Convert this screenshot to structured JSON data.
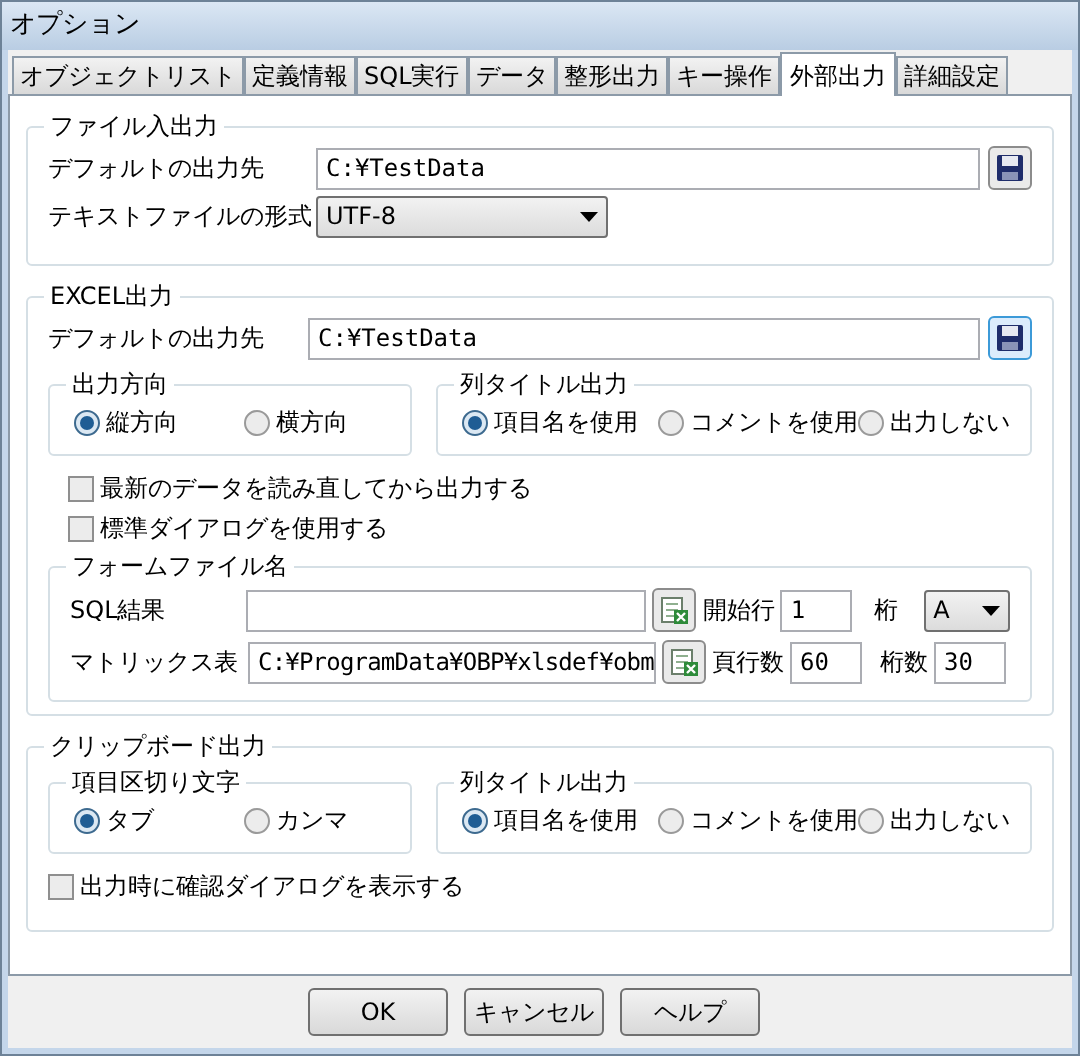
{
  "window": {
    "title": "オプション"
  },
  "tabs": [
    {
      "label": "オブジェクトリスト",
      "selected": false
    },
    {
      "label": "定義情報",
      "selected": false
    },
    {
      "label": "SQL実行",
      "selected": false
    },
    {
      "label": "データ",
      "selected": false
    },
    {
      "label": "整形出力",
      "selected": false
    },
    {
      "label": "キー操作",
      "selected": false
    },
    {
      "label": "外部出力",
      "selected": true
    },
    {
      "label": "詳細設定",
      "selected": false
    }
  ],
  "file_io": {
    "title": "ファイル入出力",
    "output_label": "デフォルトの出力先",
    "output_path": "C:¥TestData",
    "format_label": "テキストファイルの形式",
    "format_value": "UTF-8"
  },
  "excel": {
    "title": "EXCEL出力",
    "output_label": "デフォルトの出力先",
    "output_path": "C:¥TestData",
    "direction": {
      "title": "出力方向",
      "options": [
        {
          "label": "縦方向",
          "selected": true
        },
        {
          "label": "横方向",
          "selected": false
        }
      ]
    },
    "column_title": {
      "title": "列タイトル出力",
      "options": [
        {
          "label": "項目名を使用",
          "selected": true
        },
        {
          "label": "コメントを使用",
          "selected": false
        },
        {
          "label": "出力しない",
          "selected": false
        }
      ]
    },
    "checkboxes": [
      {
        "label": "最新のデータを読み直してから出力する",
        "checked": false
      },
      {
        "label": "標準ダイアログを使用する",
        "checked": false
      }
    ],
    "form_file": {
      "title": "フォームファイル名",
      "sql_result_label": "SQL結果",
      "start_row_label": "開始行",
      "start_row": "1",
      "column_label": "桁",
      "column_value": "A",
      "matrix_label": "マトリックス表",
      "matrix_path": "C:¥ProgramData¥OBP¥xlsdef¥obm",
      "page_rows_label": "頁行数",
      "page_rows": "60",
      "columns_label": "桁数",
      "columns_value": "30"
    }
  },
  "clipboard": {
    "title": "クリップボード出力",
    "separator": {
      "title": "項目区切り文字",
      "options": [
        {
          "label": "タブ",
          "selected": true
        },
        {
          "label": "カンマ",
          "selected": false
        }
      ]
    },
    "column_title": {
      "title": "列タイトル出力",
      "options": [
        {
          "label": "項目名を使用",
          "selected": true
        },
        {
          "label": "コメントを使用",
          "selected": false
        },
        {
          "label": "出力しない",
          "selected": false
        }
      ]
    },
    "checkboxes": [
      {
        "label": "出力時に確認ダイアログを表示する",
        "checked": false
      }
    ]
  },
  "buttons": [
    "OK",
    "キャンセル",
    "ヘルプ"
  ]
}
